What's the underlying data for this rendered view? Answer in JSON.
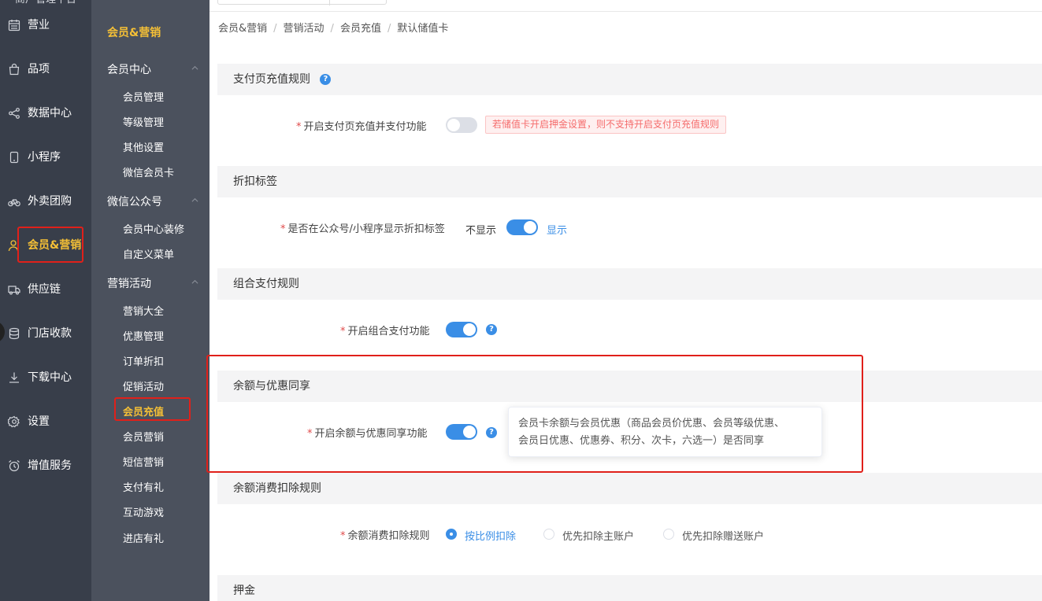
{
  "brand": "商户管理平台",
  "primary_nav": [
    {
      "label": "营业",
      "icon": "calendar-icon"
    },
    {
      "label": "品项",
      "icon": "shopping-bag-icon"
    },
    {
      "label": "数据中心",
      "icon": "share-icon"
    },
    {
      "label": "小程序",
      "icon": "mobile-icon"
    },
    {
      "label": "外卖团购",
      "icon": "bicycle-icon"
    },
    {
      "label": "会员&营销",
      "icon": "user-icon",
      "active": true
    },
    {
      "label": "供应链",
      "icon": "truck-icon"
    },
    {
      "label": "门店收款",
      "icon": "database-icon"
    },
    {
      "label": "下载中心",
      "icon": "download-icon"
    },
    {
      "label": "设置",
      "icon": "gear-icon"
    },
    {
      "label": "增值服务",
      "icon": "alarm-clock-icon"
    }
  ],
  "secondary_nav": {
    "title": "会员&营销",
    "groups": [
      {
        "label": "会员中心",
        "items": [
          "会员管理",
          "等级管理",
          "其他设置",
          "微信会员卡"
        ]
      },
      {
        "label": "微信公众号",
        "items": [
          "会员中心装修",
          "自定义菜单"
        ]
      },
      {
        "label": "营销活动",
        "items": [
          "营销大全",
          "优惠管理",
          "订单折扣",
          "促销活动",
          "会员充值",
          "会员营销",
          "短信营销",
          "支付有礼",
          "互动游戏",
          "进店有礼"
        ]
      }
    ],
    "active_item": "会员充值"
  },
  "breadcrumb": [
    "会员&营销",
    "营销活动",
    "会员充值",
    "默认储值卡"
  ],
  "sections": {
    "pay_page": {
      "title": "支付页充值规则",
      "label": "开启支付页充值并支付功能",
      "switch_on": false,
      "warning": "若储值卡开启押金设置，则不支持开启支付页充值规则"
    },
    "discount_tag": {
      "title": "折扣标签",
      "label": "是否在公众号/小程序显示折扣标签",
      "off_text": "不显示",
      "on_text": "显示",
      "switch_on": true
    },
    "combo_pay": {
      "title": "组合支付规则",
      "label": "开启组合支付功能",
      "switch_on": true
    },
    "balance_share": {
      "title": "余额与优惠同享",
      "label": "开启余额与优惠同享功能",
      "switch_on": true,
      "tooltip_line1": "会员卡余额与会员优惠（商品会员价优惠、会员等级优惠、",
      "tooltip_line2": "会员日优惠、优惠券、积分、次卡，六选一）是否同享"
    },
    "deduction": {
      "title": "余额消费扣除规则",
      "label": "余额消费扣除规则",
      "options": [
        "按比例扣除",
        "优先扣除主账户",
        "优先扣除赠送账户"
      ],
      "selected": "按比例扣除"
    },
    "deposit": {
      "title": "押金"
    }
  },
  "colors": {
    "accent": "#3a8ee6",
    "active_nav": "#f5c036",
    "highlight_border": "#e0201a",
    "required": "#e04a4a"
  }
}
